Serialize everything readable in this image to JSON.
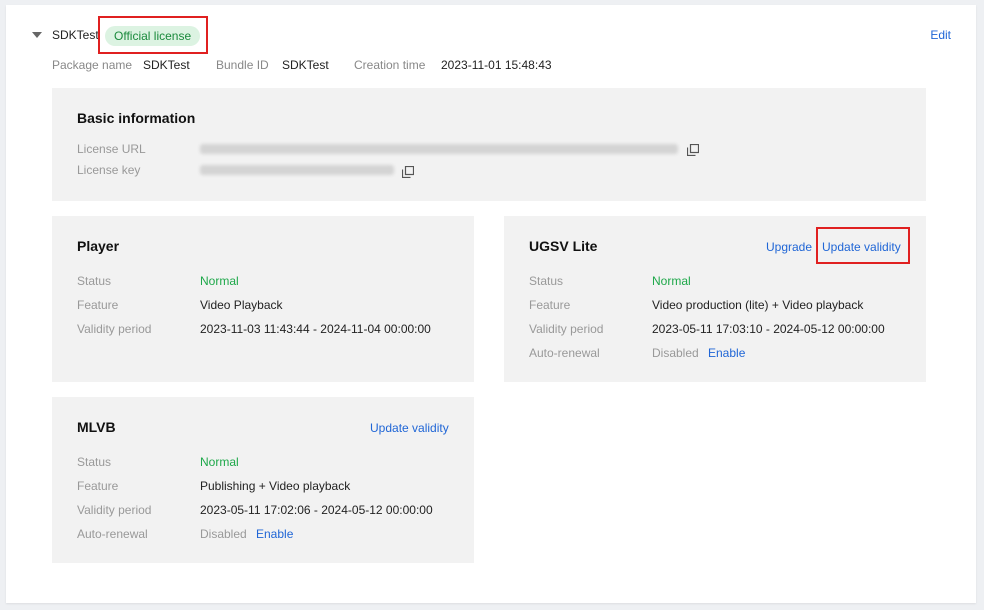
{
  "app": {
    "name": "SDKTest",
    "license_badge": "Official license",
    "edit_label": "Edit",
    "meta": {
      "package_label": "Package name",
      "package_value": "SDKTest",
      "bundle_label": "Bundle ID",
      "bundle_value": "SDKTest",
      "creation_label": "Creation time",
      "creation_value": "2023-11-01 15:48:43"
    }
  },
  "basic": {
    "title": "Basic information",
    "license_url_label": "License URL",
    "license_key_label": "License key"
  },
  "player": {
    "title": "Player",
    "status_label": "Status",
    "status_value": "Normal",
    "feature_label": "Feature",
    "feature_value": "Video Playback",
    "validity_label": "Validity period",
    "validity_value": "2023-11-03 11:43:44 - 2024-11-04 00:00:00"
  },
  "ugsv": {
    "title": "UGSV Lite",
    "upgrade_label": "Upgrade",
    "update_validity_label": "Update validity",
    "status_label": "Status",
    "status_value": "Normal",
    "feature_label": "Feature",
    "feature_value": "Video production (lite) + Video playback",
    "validity_label": "Validity period",
    "validity_value": "2023-05-11 17:03:10 - 2024-05-12 00:00:00",
    "renewal_label": "Auto-renewal",
    "renewal_value": "Disabled",
    "enable_label": "Enable"
  },
  "mlvb": {
    "title": "MLVB",
    "update_validity_label": "Update validity",
    "status_label": "Status",
    "status_value": "Normal",
    "feature_label": "Feature",
    "feature_value": "Publishing + Video playback",
    "validity_label": "Validity period",
    "validity_value": "2023-05-11 17:02:06 - 2024-05-12 00:00:00",
    "renewal_label": "Auto-renewal",
    "renewal_value": "Disabled",
    "enable_label": "Enable"
  },
  "icons": {
    "collapse": "caret-down-icon",
    "copy": "copy-icon"
  },
  "colors": {
    "link": "#2066d6",
    "status_green": "#1ea84a",
    "badge_bg": "#dcf3e2",
    "highlight": "#e02020"
  }
}
